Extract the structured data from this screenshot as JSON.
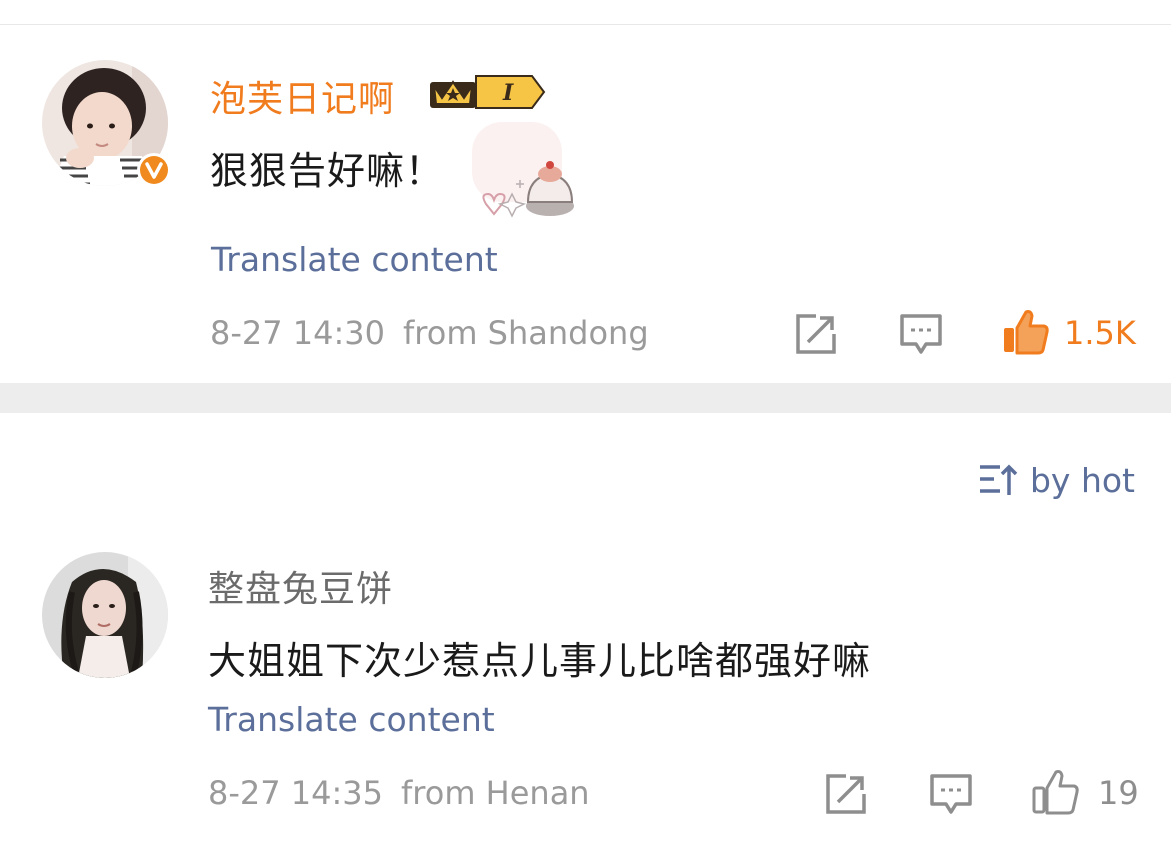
{
  "comments": [
    {
      "username": "泡芙日记啊",
      "level": "I",
      "text": "狠狠告好嘛！",
      "translate_label": "Translate content",
      "timestamp": "8-27 14:30",
      "location": "from Shandong",
      "likes": "1.5K",
      "liked": true,
      "verified": true,
      "avatar": "girl-avatar",
      "sticker": "cake-sticker"
    },
    {
      "username": "整盘兔豆饼",
      "text": "大姐姐下次少惹点儿事儿比啥都强好嘛",
      "translate_label": "Translate content",
      "timestamp": "8-27 14:35",
      "location": "from Henan",
      "likes": "19",
      "liked": false,
      "verified": false,
      "avatar": "woman-avatar"
    }
  ],
  "sort": {
    "label": "by hot",
    "icon": "sort-icon"
  },
  "colors": {
    "vip_name": "#f07c1e",
    "normal_name": "#6b6b6b",
    "link": "#5b6f9a",
    "meta": "#9a9a9a",
    "liked": "#f07c1e",
    "icon_gray": "#8e8e8e",
    "text": "#1a1a1a"
  }
}
